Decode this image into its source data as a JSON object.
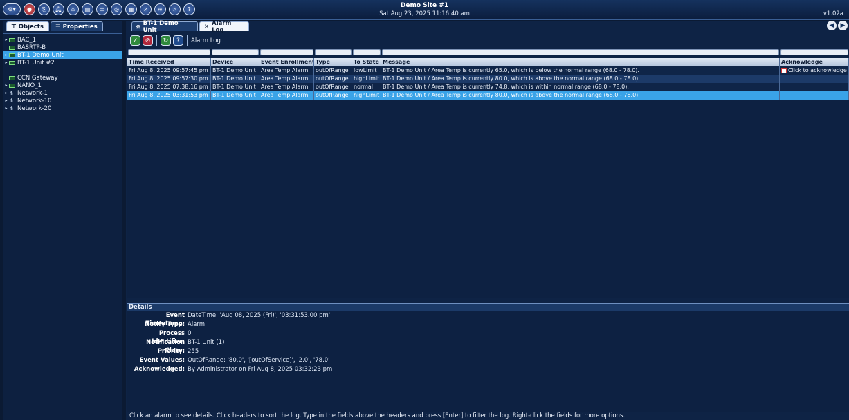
{
  "header": {
    "site_name": "Demo Site #1",
    "datetime": "Sat Aug 23, 2025 11:16:40 am",
    "version": "v1.02a"
  },
  "left_tabs": {
    "objects": "Objects",
    "properties": "Properties"
  },
  "tree": [
    {
      "label": "BAC_1",
      "kind": "device",
      "expand": true
    },
    {
      "label": "BASRTP-B",
      "kind": "device",
      "expand": false
    },
    {
      "label": "BT-1 Demo Unit",
      "kind": "device",
      "expand": true,
      "selected": true
    },
    {
      "label": "BT-1 Unit #2",
      "kind": "device",
      "expand": true
    },
    {
      "label": "CCN Gateway",
      "kind": "device",
      "expand": false
    },
    {
      "label": "NANO_1",
      "kind": "device",
      "expand": true
    },
    {
      "label": "Network-1",
      "kind": "network",
      "expand": true
    },
    {
      "label": "Network-10",
      "kind": "network",
      "expand": true
    },
    {
      "label": "Network-20",
      "kind": "network",
      "expand": true
    }
  ],
  "right_tabs": {
    "device_tab": "BT-1 Demo Unit",
    "alarm_tab": "Alarm Log"
  },
  "toolbar": {
    "label": "Alarm Log"
  },
  "columns": [
    "Time Received",
    "Device",
    "Event Enrollment",
    "Type",
    "To State",
    "Message",
    "Acknowledge"
  ],
  "rows": [
    [
      "Fri Aug 8, 2025 09:57:45 pm",
      "BT-1 Demo Unit",
      "Area Temp Alarm",
      "outOfRange",
      "lowLimit",
      "BT-1 Demo Unit / Area Temp is currently 65.0, which is below the normal range (68.0 - 78.0).",
      "Click to acknowledge"
    ],
    [
      "Fri Aug 8, 2025 09:57:30 pm",
      "BT-1 Demo Unit",
      "Area Temp Alarm",
      "outOfRange",
      "highLimit",
      "BT-1 Demo Unit / Area Temp is currently 80.0, which is above the normal range (68.0 - 78.0).",
      ""
    ],
    [
      "Fri Aug 8, 2025 07:38:16 pm",
      "BT-1 Demo Unit",
      "Area Temp Alarm",
      "outOfRange",
      "normal",
      "BT-1 Demo Unit / Area Temp is currently 74.8, which is within normal range (68.0 - 78.0).",
      ""
    ],
    [
      "Fri Aug 8, 2025 03:31:53 pm",
      "BT-1 Demo Unit",
      "Area Temp Alarm",
      "outOfRange",
      "highLimit",
      "BT-1 Demo Unit / Area Temp is currently 80.0, which is above the normal range (68.0 - 78.0).",
      ""
    ]
  ],
  "details": {
    "title": "Details",
    "fields": [
      {
        "label": "Event Timestamp:",
        "value": "DateTime: 'Aug 08, 2025 (Fri)', '03:31:53.00 pm'"
      },
      {
        "label": "Notify Type:",
        "value": "Alarm"
      },
      {
        "label": "Process Identifier:",
        "value": "0"
      },
      {
        "label": "Notification Class:",
        "value": "BT-1 Unit (1)"
      },
      {
        "label": "Priority:",
        "value": "255"
      },
      {
        "label": "Event Values:",
        "value": "OutOfRange: '80.0', '[outOfService]', '2.0', '78.0'"
      },
      {
        "label": "Acknowledged:",
        "value": "By Administrator on Fri Aug 8, 2025 03:32:23 pm"
      }
    ]
  },
  "footer": "Click an alarm to see details. Click headers to sort the log. Type in the fields above the headers and press [Enter] to filter the log. Right-click the fields for more options.",
  "colors": {
    "background": "#0b1a33",
    "selection": "#3aa3e8",
    "header": "#15325e"
  }
}
